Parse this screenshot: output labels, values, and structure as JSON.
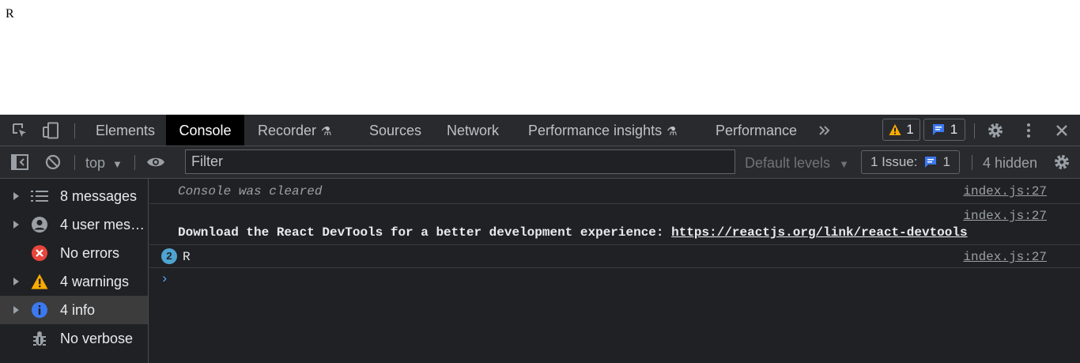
{
  "page": {
    "text": "R"
  },
  "tabs": [
    {
      "label": "Elements"
    },
    {
      "label": "Console"
    },
    {
      "label": "Recorder"
    },
    {
      "label": "Sources"
    },
    {
      "label": "Network"
    },
    {
      "label": "Performance insights"
    },
    {
      "label": "Performance"
    }
  ],
  "badges": {
    "warnings": "1",
    "messages": "1"
  },
  "toolbar": {
    "context": "top",
    "filter_placeholder": "Filter",
    "levels": "Default levels",
    "issues_label": "1 Issue:",
    "issues_count": "1",
    "hidden": "4 hidden"
  },
  "sidebar": {
    "items": [
      {
        "label": "8 messages"
      },
      {
        "label": "4 user messages"
      },
      {
        "label": "No errors"
      },
      {
        "label": "4 warnings"
      },
      {
        "label": "4 info"
      },
      {
        "label": "No verbose"
      }
    ]
  },
  "console": {
    "messages": [
      {
        "text": "Console was cleared",
        "source": "index.js:27"
      },
      {
        "text": "Download the React DevTools for a better development experience: ",
        "link": "https://reactjs.org/link/react-devtools",
        "source": "index.js:27"
      },
      {
        "count": "2",
        "text": "R",
        "source": "index.js:27"
      }
    ]
  },
  "colors": {
    "warning": "#f9ab00",
    "error": "#e8453c",
    "info": "#3c78f0",
    "message_badge": "#3c78f0",
    "prompt": "#4da6ff"
  }
}
